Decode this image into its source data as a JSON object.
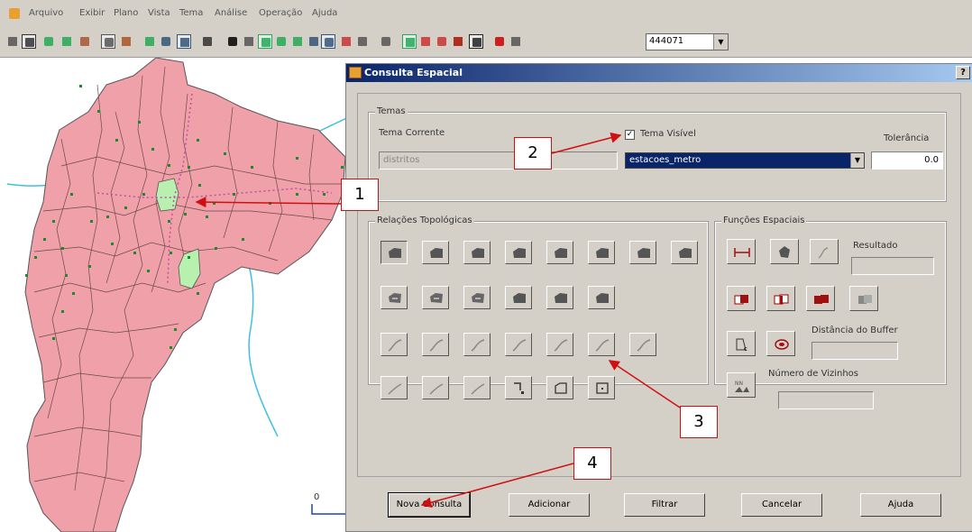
{
  "menu": [
    "Arquivo",
    "Exibir",
    "Plano",
    "Vista",
    "Tema",
    "Análise",
    "Operação",
    "Ajuda"
  ],
  "toolbar": {
    "scale_value": "444071"
  },
  "map": {
    "scale_label": "0"
  },
  "dialog": {
    "title": "Consulta Espacial",
    "help_glyph": "?",
    "temas": {
      "group_label": "Temas",
      "tema_corrente_label": "Tema Corrente",
      "tema_corrente_value": "distritos",
      "tema_visivel_label": "Tema Visível",
      "tema_visivel_checked": true,
      "tema_visivel_value": "estacoes_metro",
      "tolerancia_label": "Tolerância",
      "tolerancia_value": "0.0"
    },
    "relacoes": {
      "group_label": "Relações Topológicas"
    },
    "funcoes": {
      "group_label": "Funções Espaciais",
      "resultado_label": "Resultado",
      "distancia_label": "Distância do Buffer",
      "vizinhos_label": "Número de Vizinhos"
    },
    "buttons": {
      "nova_consulta": "Nova Consulta",
      "adicionar": "Adicionar",
      "filtrar": "Filtrar",
      "cancelar": "Cancelar",
      "ajuda": "Ajuda"
    }
  },
  "callouts": [
    "1",
    "2",
    "3",
    "4"
  ],
  "colors": {
    "map_fill": "#f0a0a8",
    "highlight": "#b8f0b0",
    "title_blue": "#0a246a",
    "callout_red": "#d01010"
  }
}
